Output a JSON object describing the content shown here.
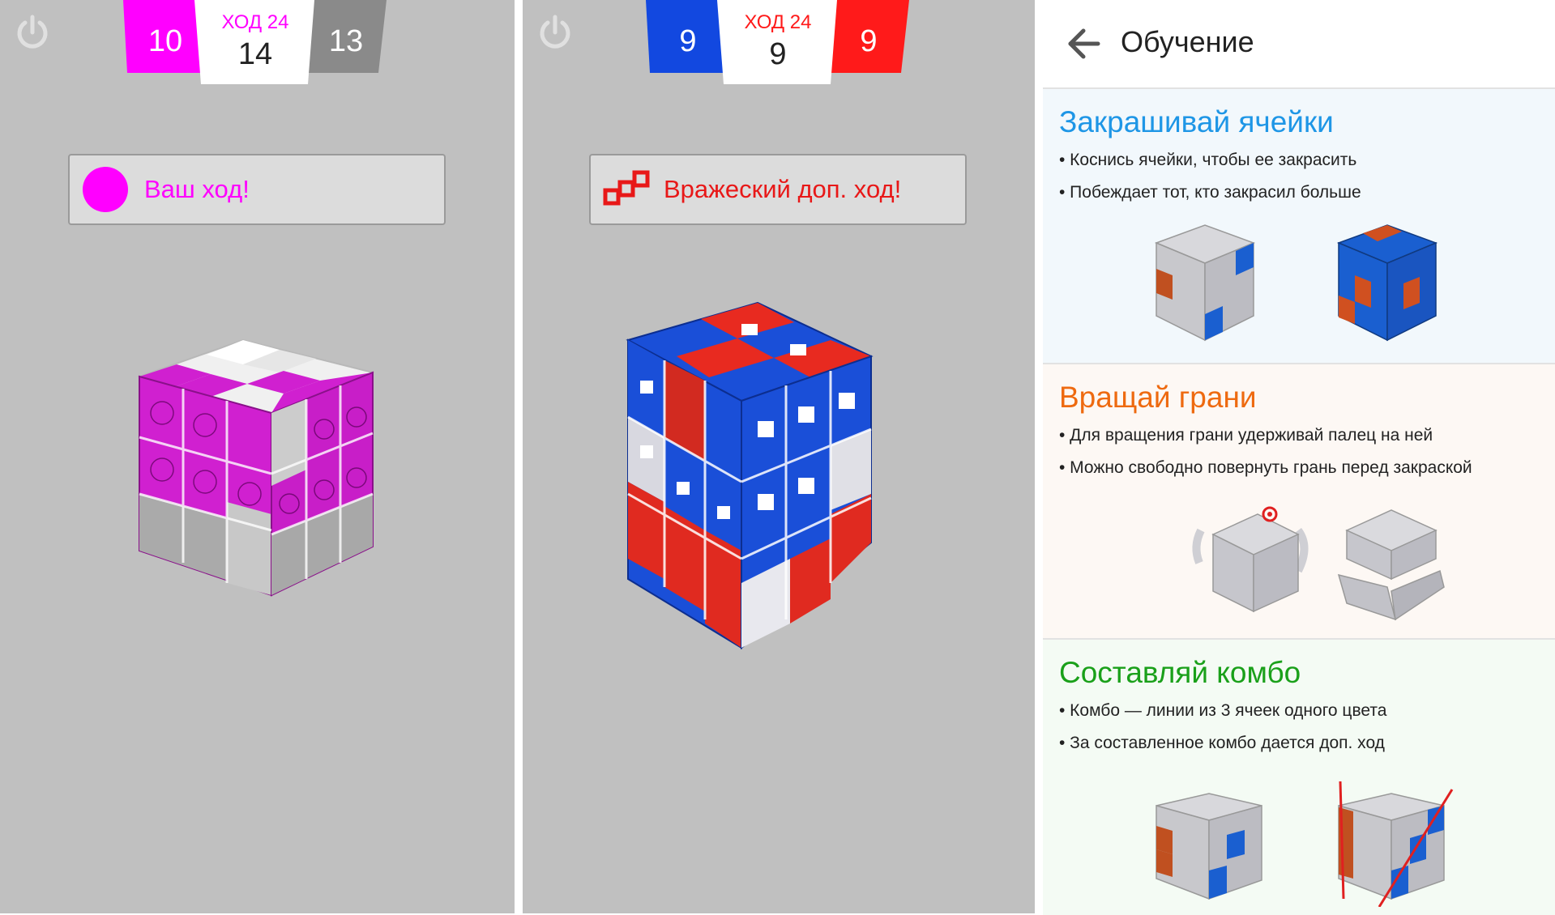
{
  "left_screen": {
    "scores": {
      "player": "10",
      "turn_label": "ХОД 24",
      "turn_number": "14",
      "opponent": "13"
    },
    "colors": {
      "player": "#ff00ff",
      "opponent": "#8a8a8a"
    },
    "status_text": "Ваш ход!",
    "icons": {
      "power": "power-icon",
      "status": "player-color-dot-icon"
    }
  },
  "middle_screen": {
    "scores": {
      "player": "9",
      "turn_label": "ХОД 24",
      "turn_number": "9",
      "opponent": "9"
    },
    "colors": {
      "player": "#1248e0",
      "opponent": "#ff1a1a"
    },
    "status_text": "Вражеский доп. ход!",
    "icons": {
      "power": "power-icon",
      "status": "extra-move-icon"
    }
  },
  "tutorial": {
    "title": "Обучение",
    "back_icon": "arrow-left-icon",
    "sections": [
      {
        "heading": "Закрашивай ячейки",
        "color": "#1e96e6",
        "bullets": [
          "• Коснись ячейки, чтобы ее закрасить",
          "• Побеждает тот, кто закрасил больше"
        ]
      },
      {
        "heading": "Вращай грани",
        "color": "#ee6a10",
        "bullets": [
          "• Для вращения грани удерживай палец на ней",
          "• Можно свободно повернуть грань перед закраской"
        ]
      },
      {
        "heading": "Составляй комбо",
        "color": "#1aa01a",
        "bullets": [
          "• Комбо — линии из 3 ячеек одного цвета",
          "• За составленное комбо дается доп. ход"
        ]
      }
    ]
  }
}
